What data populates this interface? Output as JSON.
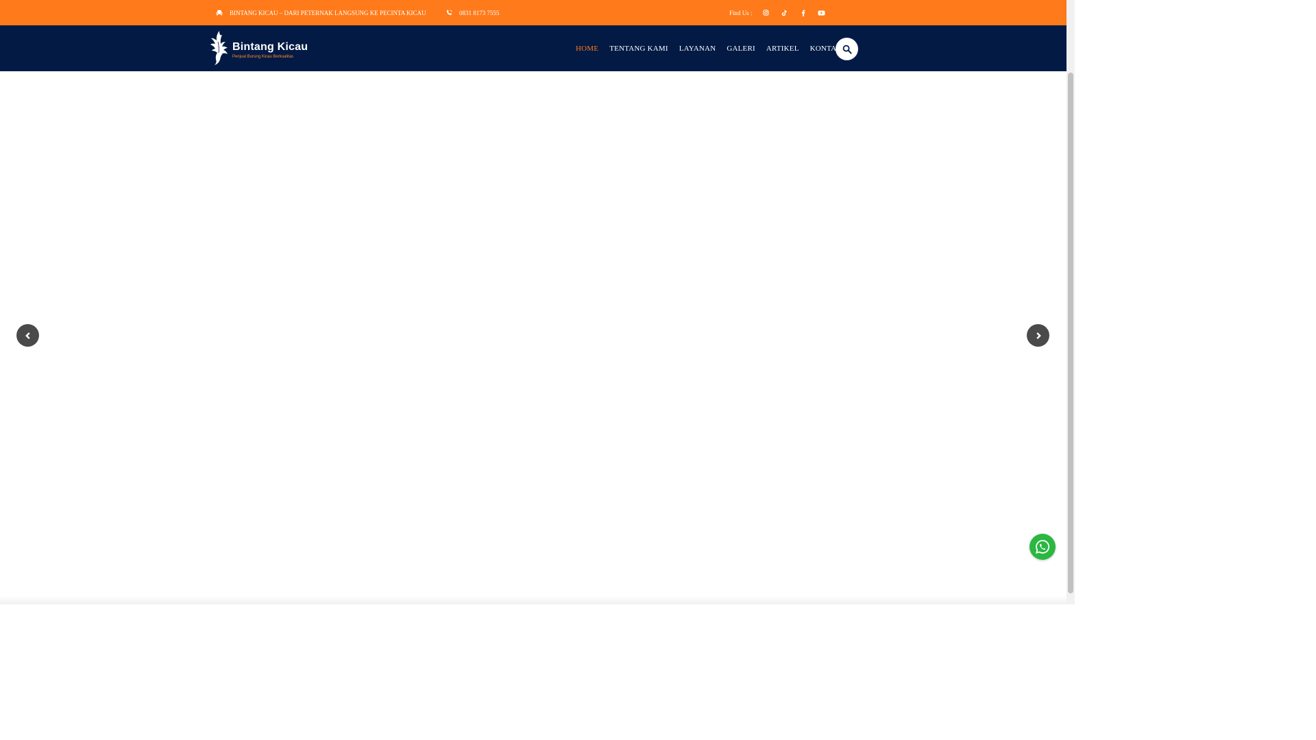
{
  "topbar": {
    "tagline": "BINTANG KICAU – DARI PETERNAK LANGSUNG KE PECINTA KICAU",
    "phone": "0831 8173 7555",
    "find_label": "Find Us :",
    "socials": [
      "instagram-icon",
      "tiktok-icon",
      "facebook-icon",
      "youtube-icon"
    ]
  },
  "logo": {
    "brand": "Bintang Kicau",
    "subtitle": "Penjual Burung Kicau Berkualitas"
  },
  "nav": {
    "items": [
      {
        "label": "HOME",
        "active": true
      },
      {
        "label": "TENTANG KAMI",
        "active": false
      },
      {
        "label": "LAYANAN",
        "active": false
      },
      {
        "label": "GALERI",
        "active": false
      },
      {
        "label": "ARTIKEL",
        "active": false
      },
      {
        "label": "KONTAK",
        "active": false
      }
    ]
  },
  "colors": {
    "accent": "#ff7a1a",
    "navbar": "#021a44",
    "whatsapp": "#2bb741",
    "arrow": "#4a4a4a"
  }
}
